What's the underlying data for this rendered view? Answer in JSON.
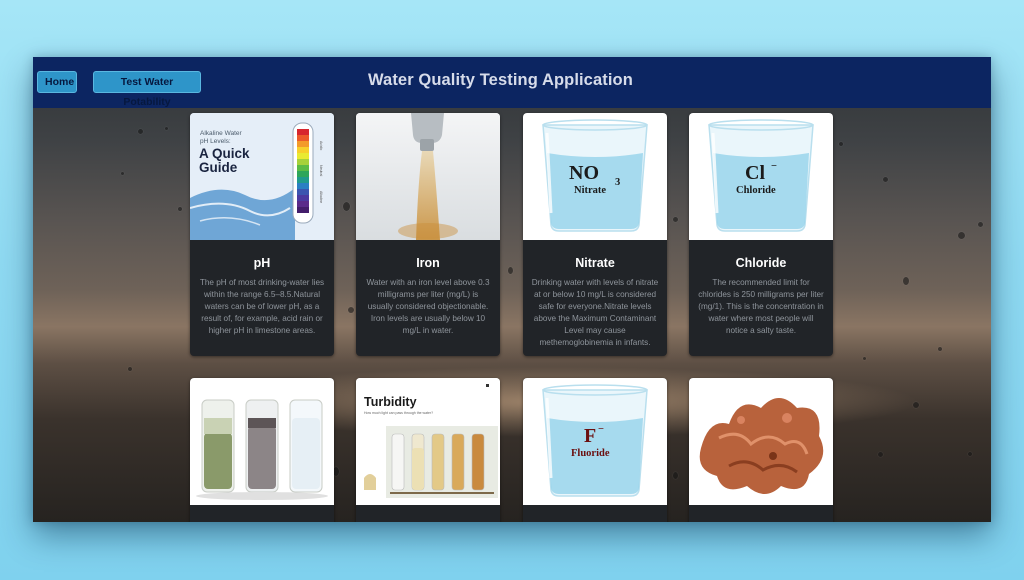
{
  "nav": {
    "home_label": "Home",
    "test_label": "Test Water Potability",
    "title": "Water Quality Testing Application"
  },
  "cards": [
    {
      "title": "pH",
      "text": "The pH of most drinking-water lies within the range 6.5–8.5.Natural waters can be of lower pH, as a result of, for example, acid rain or higher pH in limestone areas.",
      "image": {
        "line1": "Alkaline Water",
        "line2": "pH Levels:",
        "headline1": "A Quick",
        "headline2": "Guide",
        "scale_acidic": "Acidic",
        "scale_neutral": "Neutral",
        "scale_alkaline": "Alkaline"
      }
    },
    {
      "title": "Iron",
      "text": "Water with an iron level above 0.3 milligrams per liter (mg/L) is usually considered objectionable. Iron levels are usually below 10 mg/L in water.",
      "image": {
        "icon": "faucet-icon"
      }
    },
    {
      "title": "Nitrate",
      "text": "Drinking water with levels of nitrate at or below 10 mg/L is considered safe for everyone.Nitrate levels above the Maximum Contaminant Level may cause methemoglobinemia in infants.",
      "image": {
        "formula": "NO",
        "subscript": "3",
        "name": "Nitrate"
      }
    },
    {
      "title": "Chloride",
      "text": "The recommended limit for chlorides is 250 milligrams per liter (mg/1). This is the concentration in water where most people will notice a salty taste.",
      "image": {
        "formula": "Cl",
        "superscript": "−",
        "name": "Chloride"
      }
    },
    {
      "title": "",
      "text": "",
      "image": {
        "icon": "test-tubes-icon"
      }
    },
    {
      "title": "",
      "text": "",
      "image": {
        "heading": "Turbidity",
        "sub": "How much light can pass through the water?"
      }
    },
    {
      "title": "",
      "text": "",
      "image": {
        "formula": "F",
        "superscript": "−",
        "name": "Fluoride"
      }
    },
    {
      "title": "",
      "text": "",
      "image": {
        "icon": "copper-nugget-icon"
      }
    }
  ],
  "colors": {
    "navbar": "#0c2561",
    "button": "#2e95c9",
    "card_body": "#212428",
    "card_text": "#8f959c"
  }
}
